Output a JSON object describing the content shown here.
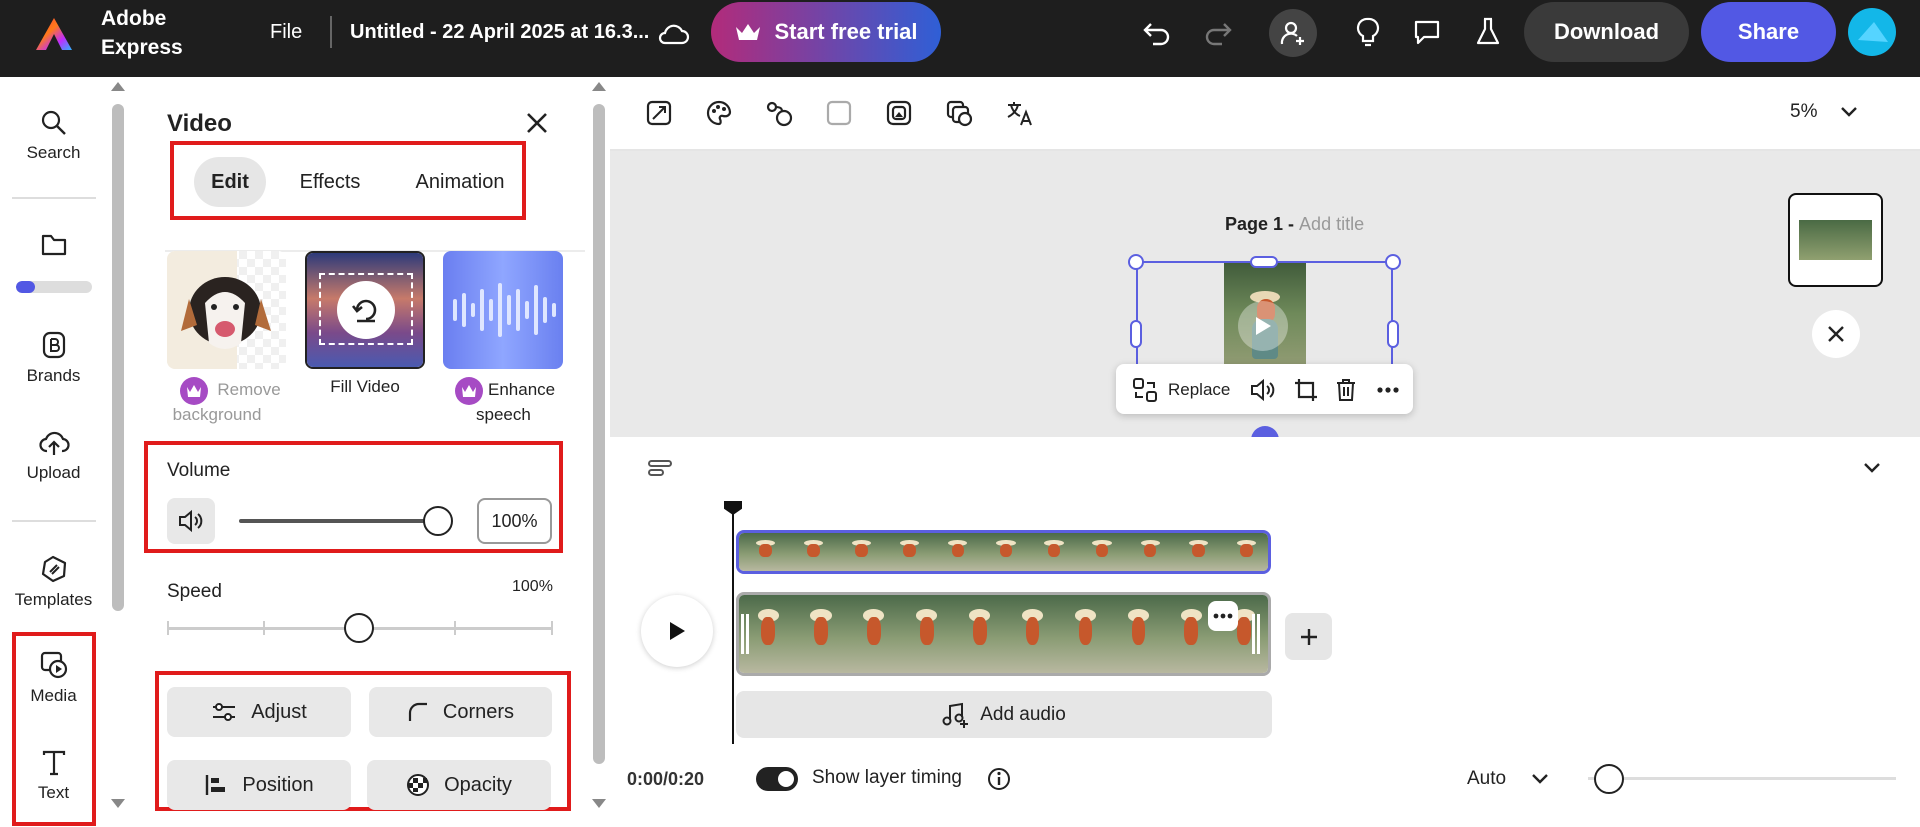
{
  "topbar": {
    "app_name_line1": "Adobe",
    "app_name_line2": "Express",
    "file_label": "File",
    "doc_title": "Untitled - 22 April 2025 at 16.3...",
    "trial_label": "Start free trial",
    "download_label": "Download",
    "share_label": "Share",
    "colors": {
      "trial_grad_start": "#b22b7a",
      "trial_grad_end": "#2f5fd6",
      "share": "#5258e4",
      "download": "#3a3a3a"
    }
  },
  "rail": {
    "items": [
      {
        "label": "Search",
        "icon": "search-icon"
      },
      {
        "label": "",
        "icon": "folder-icon"
      },
      {
        "label": "Brands",
        "icon": "brands-icon"
      },
      {
        "label": "Upload",
        "icon": "upload-icon"
      },
      {
        "label": "Templates",
        "icon": "templates-icon"
      },
      {
        "label": "Media",
        "icon": "media-icon"
      },
      {
        "label": "Text",
        "icon": "text-icon"
      }
    ],
    "progress": 0.25
  },
  "panel": {
    "title": "Video",
    "tabs": [
      "Edit",
      "Effects",
      "Animation"
    ],
    "active_tab": "Edit",
    "features": [
      {
        "line1": "Remove",
        "line2": "background",
        "premium": true
      },
      {
        "line1": "Fill Video",
        "line2": "",
        "premium": false
      },
      {
        "line1": "Enhance",
        "line2": "speech",
        "premium": true
      }
    ],
    "volume": {
      "label": "Volume",
      "value": "100%",
      "level": 1.0
    },
    "speed": {
      "label": "Speed",
      "value": "100%",
      "level": 0.5
    },
    "buttons": [
      "Adjust",
      "Corners",
      "Position",
      "Opacity"
    ]
  },
  "canvas": {
    "zoom": "5%",
    "page_label": "Page 1 -",
    "page_title_placeholder": "Add title",
    "replace_label": "Replace"
  },
  "timeline": {
    "add_audio_label": "Add audio",
    "time": "0:00/0:20",
    "layer_timing_label": "Show layer timing",
    "layer_timing_on": true,
    "zoom_mode": "Auto"
  }
}
